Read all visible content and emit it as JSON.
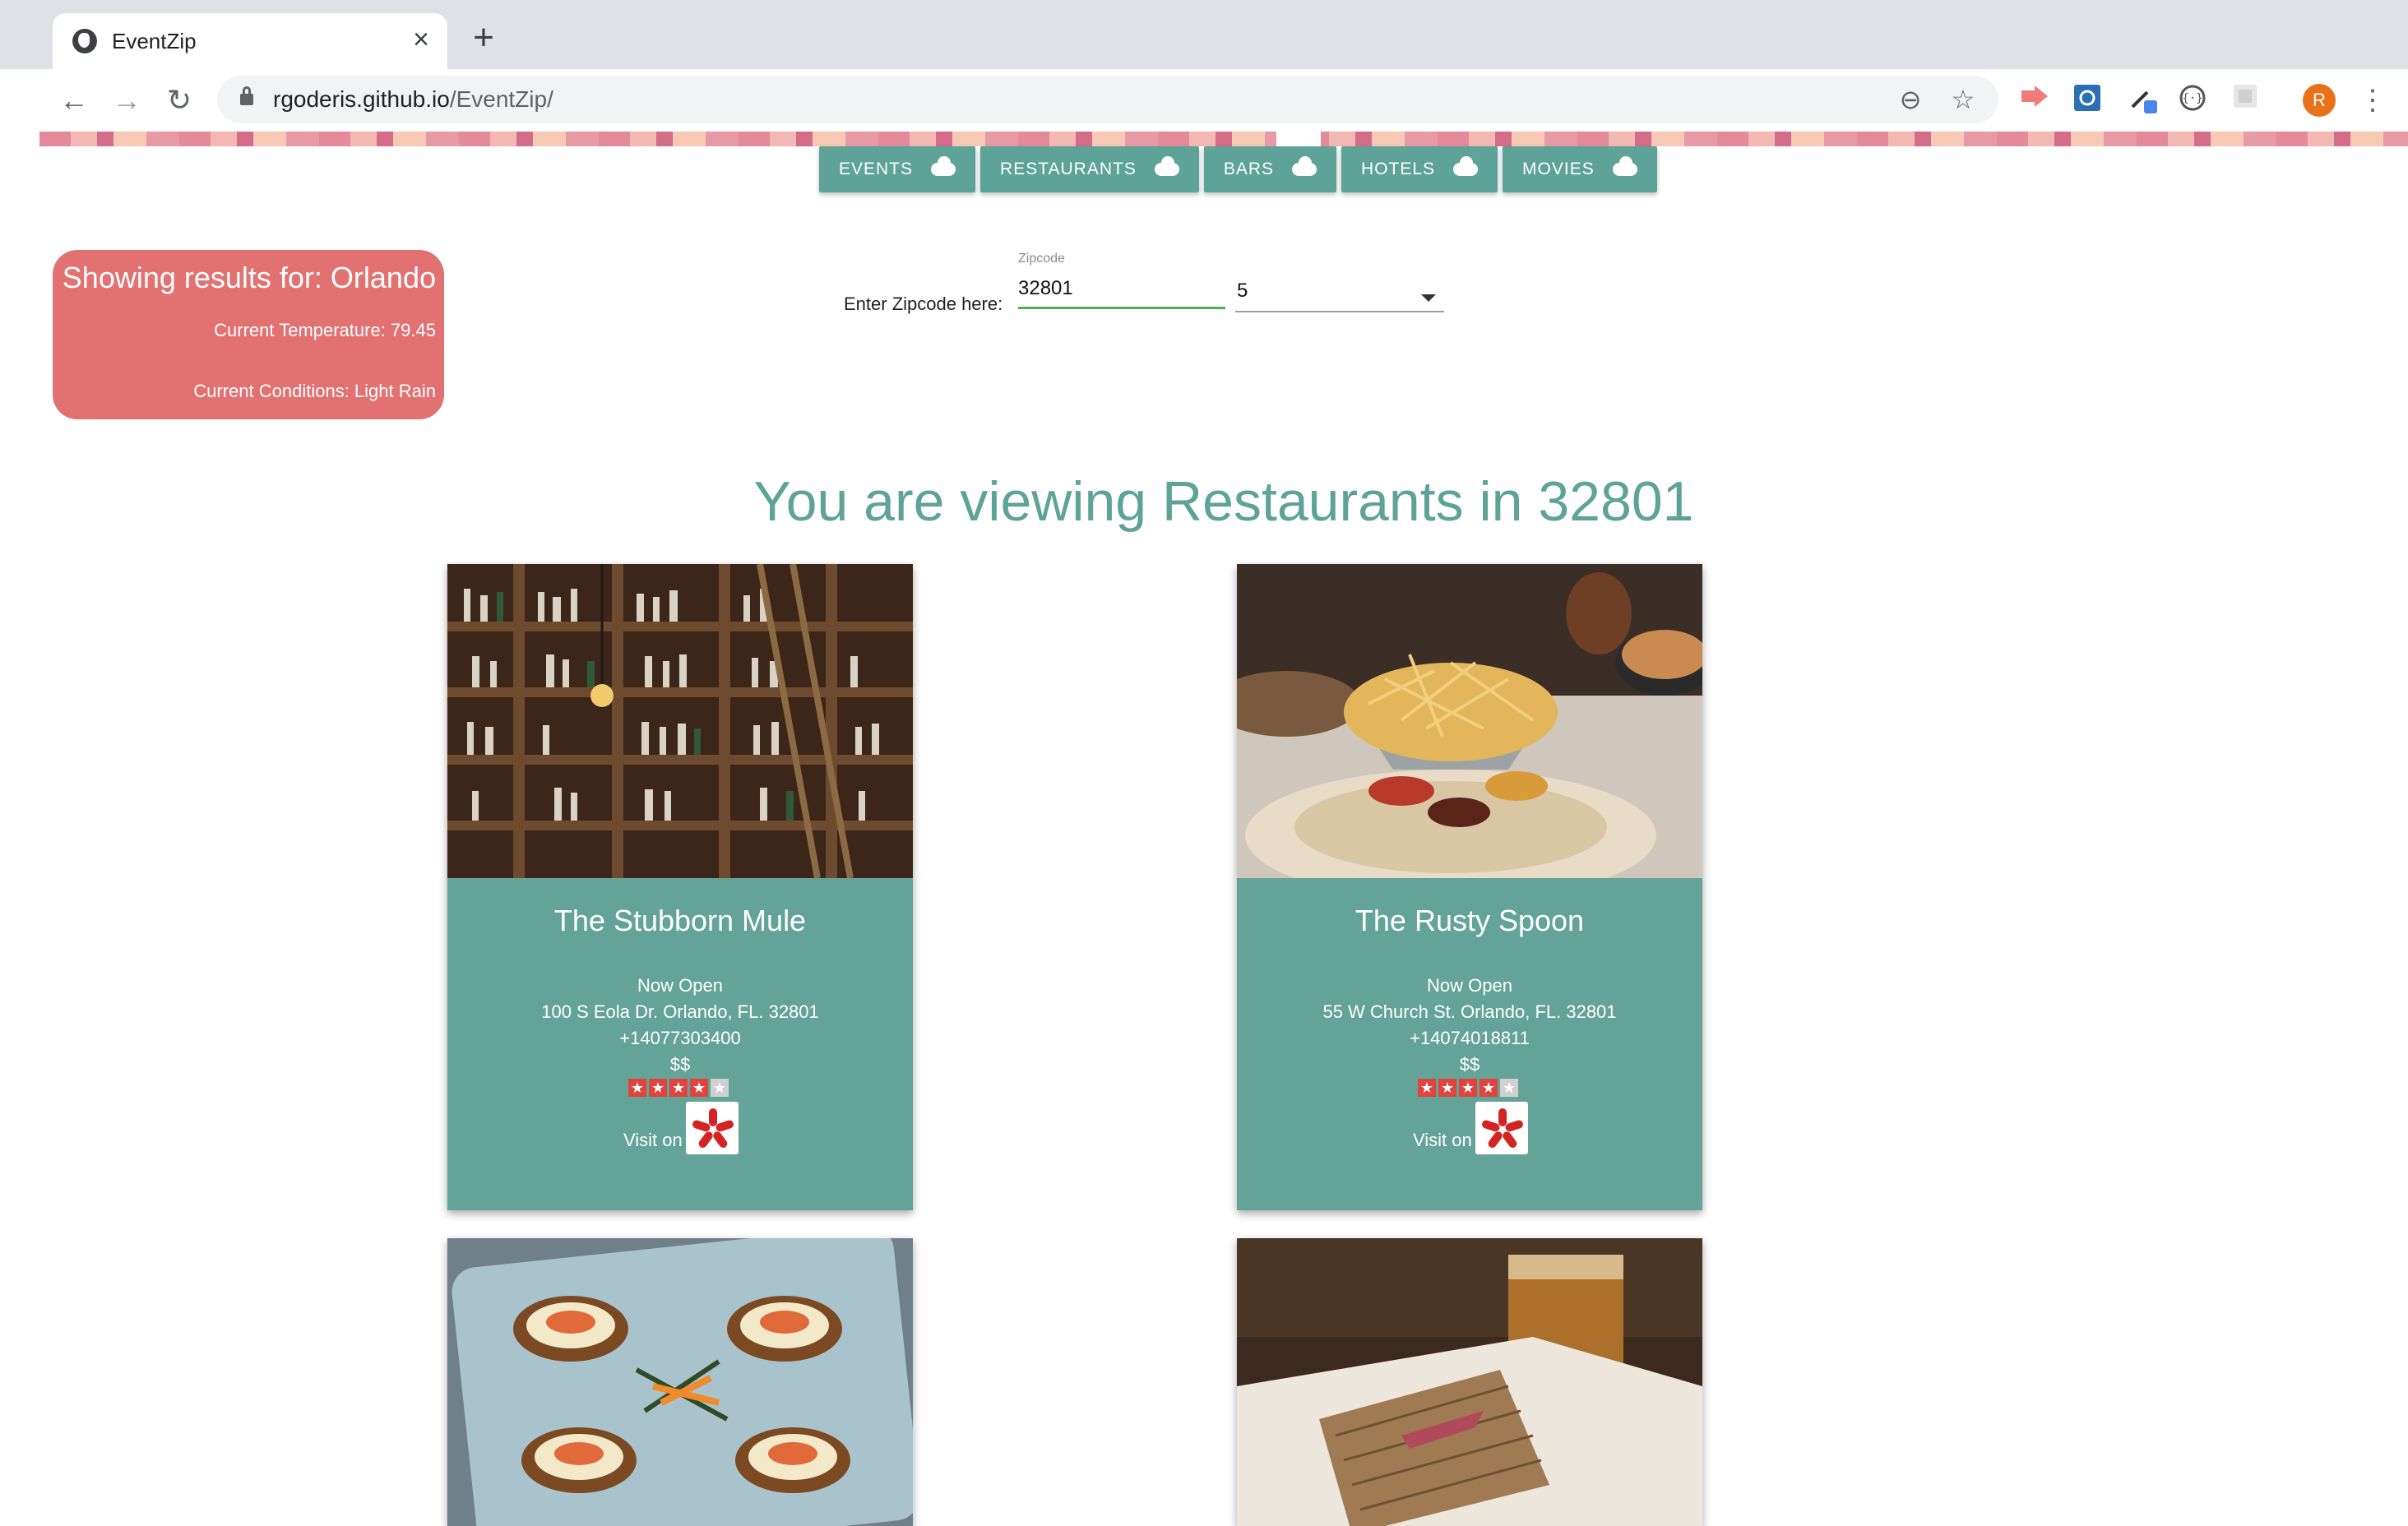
{
  "browser": {
    "tab_title": "EventZip",
    "tab_close": "×",
    "new_tab": "+",
    "url_domain": "rgoderis.github.io",
    "url_path": "/EventZip/",
    "avatar_letter": "R",
    "nav_back": "←",
    "nav_forward": "→",
    "nav_reload": "↻",
    "zoom_icon": "⊖",
    "bookmark_icon": "☆",
    "menu": "⋮"
  },
  "nav": {
    "buttons": [
      {
        "label": "EVENTS"
      },
      {
        "label": "RESTAURANTS"
      },
      {
        "label": "BARS"
      },
      {
        "label": "HOTELS"
      },
      {
        "label": "MOVIES"
      }
    ]
  },
  "weather": {
    "title": "Showing results for: Orlando",
    "temperature": "Current Temperature: 79.45",
    "conditions": "Current Conditions: Light Rain"
  },
  "search": {
    "prompt": "Enter Zipcode here:",
    "field_label": "Zipcode",
    "zipcode": "32801",
    "radius": "5"
  },
  "heading": "You are viewing Restaurants in 32801",
  "cards": [
    {
      "name": "The Stubborn Mule",
      "status": "Now Open",
      "address": "100 S Eola Dr. Orlando, FL. 32801",
      "phone": "+14077303400",
      "price": "$$",
      "rating": 4,
      "rating_max": 5,
      "visit_label": "Visit on",
      "photo": "bar-shelves-photo"
    },
    {
      "name": "The Rusty Spoon",
      "status": "Now Open",
      "address": "55 W Church St. Orlando, FL. 32801",
      "phone": "+14074018811",
      "price": "$$",
      "rating": 4,
      "rating_max": 5,
      "visit_label": "Visit on",
      "photo": "fries-plate-photo"
    },
    {
      "photo": "deviled-eggs-plate-photo"
    },
    {
      "photo": "sandwich-beer-photo"
    }
  ],
  "colors": {
    "accent_teal": "#5ea398",
    "card_teal": "#64a398",
    "weather_red": "#e27272",
    "star_red": "#e0443e",
    "yelp_red": "#d32323"
  }
}
